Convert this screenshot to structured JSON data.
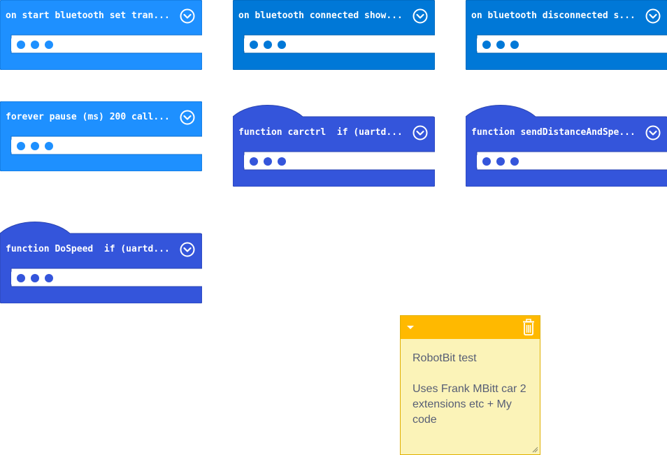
{
  "colors": {
    "event_block": "#1e90ff",
    "event_block_selected": "#0078d7",
    "function_block": "#3455db",
    "comment_header": "#ffb900",
    "comment_body": "#fbf3b8",
    "comment_text": "#575e75"
  },
  "blocks": [
    {
      "label": "on start bluetooth set tran...",
      "kind": "event",
      "collapsed": true
    },
    {
      "label": "on bluetooth connected show...",
      "kind": "event",
      "collapsed": true
    },
    {
      "label": "on bluetooth disconnected s...",
      "kind": "event",
      "collapsed": true
    },
    {
      "label": "forever pause (ms) 200 call...",
      "kind": "event",
      "collapsed": true
    },
    {
      "label": "function carctrl  if (uartd...",
      "kind": "function",
      "collapsed": true
    },
    {
      "label": "function sendDistanceAndSpe...",
      "kind": "function",
      "collapsed": true
    },
    {
      "label": "function DoSpeed  if (uartd...",
      "kind": "function",
      "collapsed": true
    }
  ],
  "icons": {
    "expand": "chevron-down-circle-icon",
    "collapsed_content": "ellipsis-dots-icon",
    "comment_minimize": "caret-down-icon",
    "comment_delete": "trash-icon",
    "comment_resize": "resize-grip-icon"
  },
  "comment": {
    "text": "RobotBit test\n\nUses Frank MBitt car 2 extensions etc + My code"
  }
}
